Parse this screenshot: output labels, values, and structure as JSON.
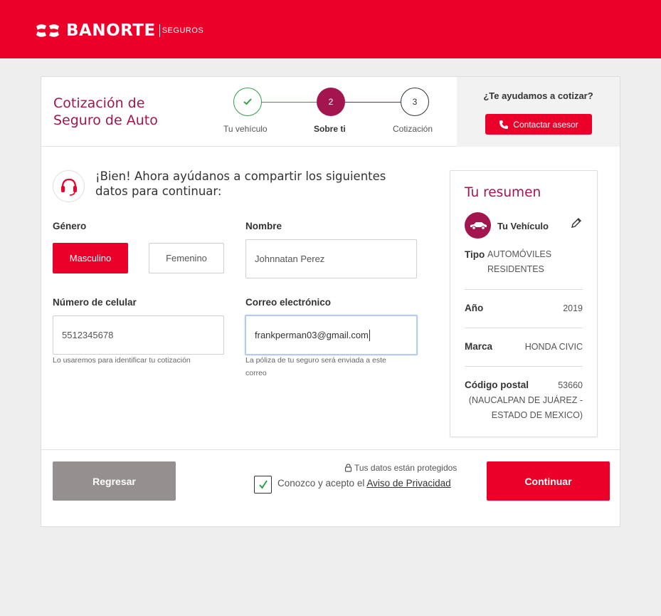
{
  "brand": {
    "name": "BANORTE",
    "sub": "SEGUROS"
  },
  "header": {
    "title_line1": "Cotización de",
    "title_line2": "Seguro de Auto",
    "steps": [
      {
        "number": "1",
        "label": "Tu vehículo",
        "state": "done"
      },
      {
        "number": "2",
        "label": "Sobre ti",
        "state": "current"
      },
      {
        "number": "3",
        "label": "Cotización",
        "state": "pending"
      }
    ],
    "help_question": "¿Te ayudamos a cotizar?",
    "help_button": "Contactar asesor"
  },
  "form": {
    "lead_line1": "¡Bien! Ahora ayúdanos a compartir los siguientes",
    "lead_line2": "datos para continuar:",
    "gender_label": "Género",
    "gender_options": [
      "Masculino",
      "Femenino"
    ],
    "gender_selected": "Masculino",
    "name_label": "Nombre",
    "name_value": "Johnnatan Perez",
    "phone_label": "Número de celular",
    "phone_value": "5512345678",
    "phone_hint": "Lo usaremos para identificar tu cotización",
    "email_label": "Correo electrónico",
    "email_value": "frankperman03@gmail.com",
    "email_hint_line1": "La póliza de tu seguro será enviada a este",
    "email_hint_line2": "correo"
  },
  "summary": {
    "title": "Tu resumen",
    "vehicle_heading": "Tu Vehículo",
    "tipo_label": "Tipo",
    "tipo_value_line1": "AUTOMÓVILES",
    "tipo_value_line2": "RESIDENTES",
    "anio_label": "Año",
    "anio_value": "2019",
    "marca_label": "Marca",
    "marca_value": "HONDA CIVIC",
    "cp_label": "Código postal",
    "cp_value": "53660",
    "cp_place_line1": "(NAUCALPAN DE JUÁREZ -",
    "cp_place_line2": "ESTADO DE MEXICO)"
  },
  "footer": {
    "back_label": "Regresar",
    "protected_text": "Tus datos están protegidos",
    "privacy_checked": true,
    "accept_prefix": "Conozco y acepto el",
    "privacy_link": "Aviso de Privacidad",
    "continue_label": "Continuar"
  },
  "colors": {
    "brand_red": "#eb0029",
    "accent_maroon": "#a3154f",
    "done_green": "#2ea043",
    "back_gray": "#968f8f"
  },
  "icons": [
    "banorte-logo",
    "check-icon",
    "phone-icon",
    "headset-icon",
    "car-icon",
    "edit-icon",
    "lock-icon"
  ]
}
